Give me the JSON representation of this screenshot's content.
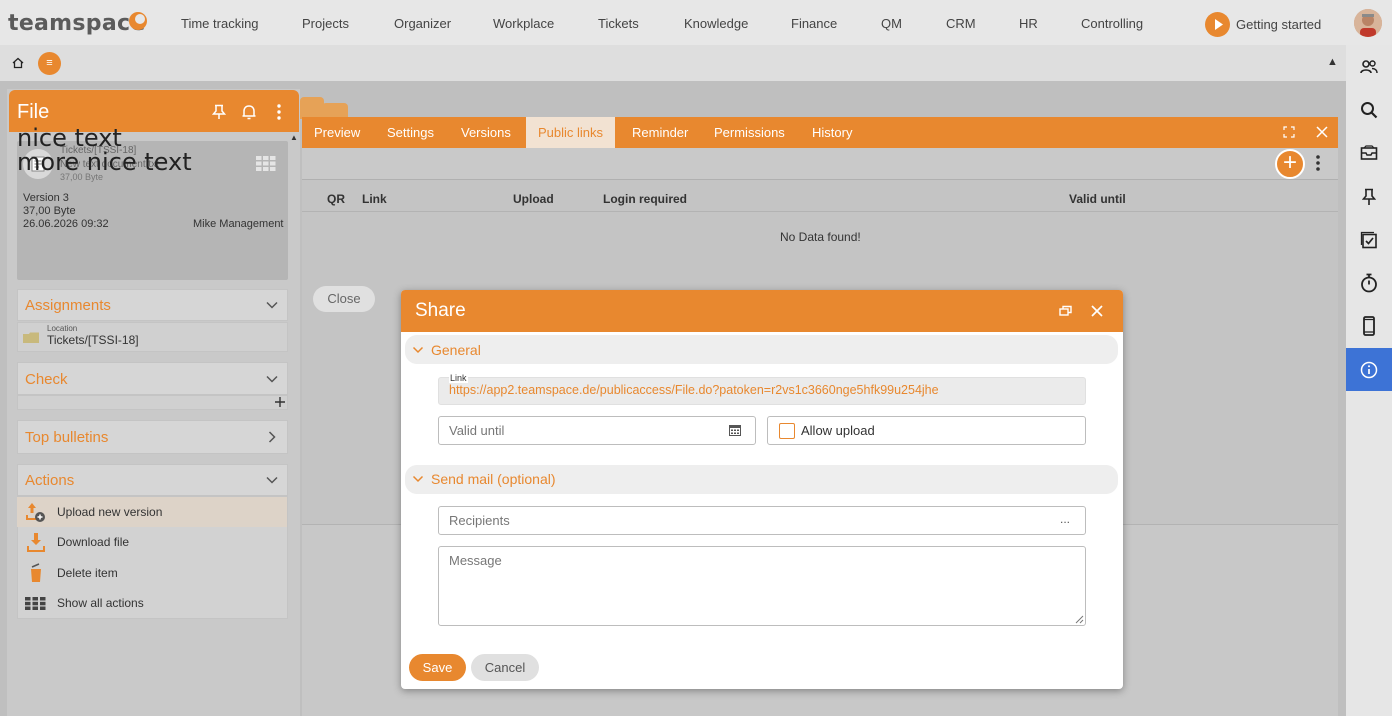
{
  "app": {
    "logo_text": "teamspace"
  },
  "topnav": {
    "items": [
      "Time tracking",
      "Projects",
      "Organizer",
      "Workplace",
      "Tickets",
      "Knowledge",
      "Finance",
      "QM",
      "CRM",
      "HR",
      "Controlling"
    ],
    "getting_started": "Getting started"
  },
  "colors": {
    "accent": "#e8882f",
    "active_blue": "#3d73d6"
  },
  "secondbar": {
    "menu_glyph": "≡"
  },
  "right_sidebar": {
    "icons": [
      "users-icon",
      "search-icon",
      "inbox-icon",
      "pin-icon",
      "checklist-icon",
      "stopwatch-icon",
      "mobile-icon",
      "info-icon"
    ],
    "active": "info-icon"
  },
  "file_panel": {
    "title": "File",
    "overlay_line1": "nice text",
    "overlay_line2": "more nice text",
    "card": {
      "path": "Tickets/[TSSI-18]",
      "name": "New text document.txt",
      "size_small": "37,00 Byte",
      "version": "Version 3",
      "size": "37,00 Byte",
      "date": "26.06.2026 09:32",
      "author": "Mike Management"
    },
    "assignments": {
      "title": "Assignments",
      "location_label": "Location",
      "location_value": "Tickets/[TSSI-18]"
    },
    "check": {
      "title": "Check"
    },
    "top_bulletins": {
      "title": "Top bulletins"
    },
    "actions": {
      "title": "Actions",
      "items": [
        "Upload new version",
        "Download file",
        "Delete item",
        "Show all actions"
      ]
    }
  },
  "main_panel": {
    "tabs": [
      "Preview",
      "Settings",
      "Versions",
      "Public links",
      "Reminder",
      "Permissions",
      "History"
    ],
    "active_tab": "Public links",
    "columns": [
      "QR",
      "Link",
      "Upload",
      "Login required",
      "Valid until"
    ],
    "empty_text": "No Data found!",
    "close_label": "Close"
  },
  "dialog": {
    "title": "Share",
    "general_label": "General",
    "link_label": "Link",
    "link_value": "https://app2.teamspace.de/publicaccess/File.do?patoken=r2vs1c3660nge5hfk99u254jhe",
    "valid_until_placeholder": "Valid until",
    "allow_upload_label": "Allow upload",
    "send_mail_label": "Send mail (optional)",
    "recipients_placeholder": "Recipients",
    "recipients_more": "...",
    "message_placeholder": "Message",
    "save_label": "Save",
    "cancel_label": "Cancel"
  }
}
